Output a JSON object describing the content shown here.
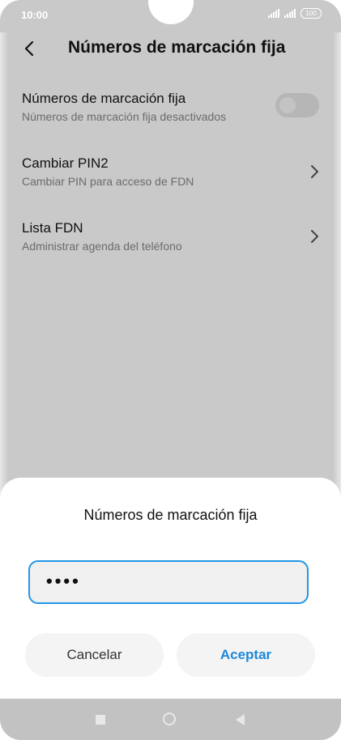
{
  "status_bar": {
    "time": "10:00",
    "battery": "100"
  },
  "app_bar": {
    "title": "Números de marcación fija",
    "back_icon": "back-arrow-icon"
  },
  "settings": [
    {
      "title": "Números de marcación fija",
      "subtitle": "Números de marcación fija desactivados",
      "control": "toggle",
      "toggle_on": false
    },
    {
      "title": "Cambiar PIN2",
      "subtitle": "Cambiar PIN para acceso de FDN",
      "control": "chevron"
    },
    {
      "title": "Lista FDN",
      "subtitle": "Administrar agenda del teléfono",
      "control": "chevron"
    }
  ],
  "dialog": {
    "title": "Números de marcación fija",
    "pin_value": "••••",
    "cancel_label": "Cancelar",
    "accept_label": "Aceptar"
  },
  "colors": {
    "accent": "#1e88d8",
    "input_border": "#2196e6",
    "overlay": "#c9c9c9"
  }
}
